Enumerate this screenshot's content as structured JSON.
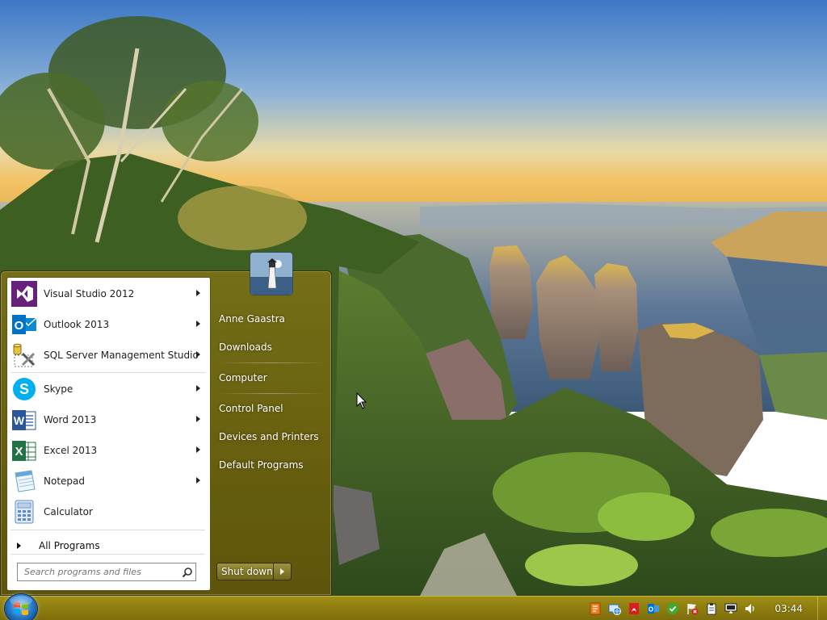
{
  "start_menu": {
    "programs": [
      {
        "name": "visual-studio",
        "label": "Visual Studio 2012",
        "icon": "visual-studio-icon",
        "color": "#68217a",
        "has_submenu": true
      },
      {
        "name": "outlook",
        "label": "Outlook 2013",
        "icon": "outlook-icon",
        "color": "#0072c6",
        "has_submenu": true
      },
      {
        "name": "sql-server",
        "label": "SQL Server Management Studio",
        "icon": "sql-server-management-studio-icon",
        "color": "#c8a020",
        "has_submenu": true
      },
      {
        "name": "skype",
        "label": "Skype",
        "icon": "skype-icon",
        "color": "#00aff0",
        "has_submenu": true
      },
      {
        "name": "word",
        "label": "Word 2013",
        "icon": "word-icon",
        "color": "#2b579a",
        "has_submenu": true
      },
      {
        "name": "excel",
        "label": "Excel 2013",
        "icon": "excel-icon",
        "color": "#217346",
        "has_submenu": true
      },
      {
        "name": "notepad",
        "label": "Notepad",
        "icon": "notepad-icon",
        "color": "#6aa7d8",
        "has_submenu": true
      },
      {
        "name": "calculator",
        "label": "Calculator",
        "icon": "calculator-icon",
        "color": "#5b8bc9",
        "has_submenu": false
      }
    ],
    "all_programs_label": "All Programs",
    "search_placeholder": "Search programs and files",
    "right_links": [
      {
        "name": "user",
        "label": "Anne Gaastra"
      },
      {
        "name": "downloads",
        "label": "Downloads"
      },
      {
        "name": "computer",
        "label": "Computer"
      },
      {
        "name": "control-panel",
        "label": "Control Panel"
      },
      {
        "name": "devices-printers",
        "label": "Devices and Printers"
      },
      {
        "name": "default-programs",
        "label": "Default Programs"
      }
    ],
    "shutdown_label": "Shut down",
    "accent_color": "#8a7a12"
  },
  "taskbar": {
    "clock": "03:44",
    "tray_icons": [
      "shield-alert-icon",
      "network-globe-icon",
      "pdf-icon",
      "outlook-tray-icon",
      "security-check-icon",
      "action-center-flag-icon",
      "clipboard-icon",
      "display-icon",
      "volume-icon"
    ]
  }
}
